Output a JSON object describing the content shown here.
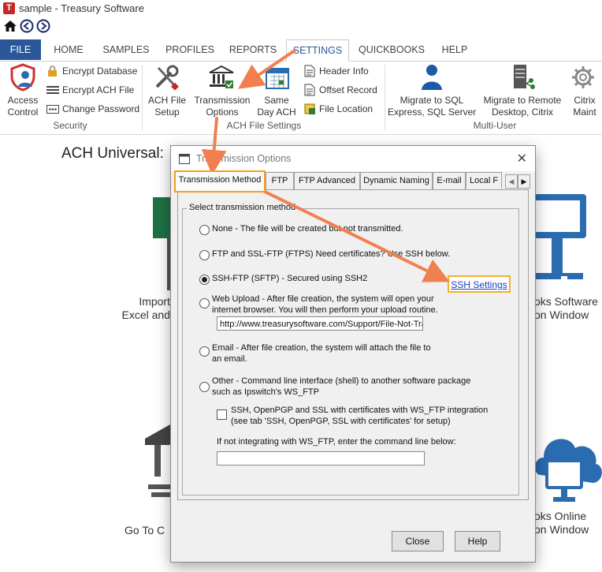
{
  "window": {
    "title": "sample - Treasury Software"
  },
  "ribbon_tabs": [
    "FILE",
    "HOME",
    "SAMPLES",
    "PROFILES",
    "REPORTS",
    "SETTINGS",
    "QUICKBOOKS",
    "HELP"
  ],
  "ribbon": {
    "access_control": "Access\nControl",
    "encrypt_database": "Encrypt Database",
    "encrypt_ach_file": "Encrypt ACH File",
    "change_password": "Change Password",
    "security_group": "Security",
    "ach_file_setup": "ACH File\nSetup",
    "transmission_options": "Transmission\nOptions",
    "same_day_ach": "Same\nDay ACH",
    "header_info": "Header Info",
    "offset_record": "Offset Record",
    "file_location": "File Location",
    "ach_file_settings_group": "ACH File Settings",
    "migrate_sql": "Migrate to SQL\nExpress, SQL Server",
    "migrate_remote": "Migrate to Remote\nDesktop, Citrix",
    "citrix_maint": "Citrix\nMaint",
    "multi_user_group": "Multi-User"
  },
  "main": {
    "heading": "ACH Universal:",
    "import_label": "Import\nExcel and",
    "quickbooks_label": "oks Software\non Window",
    "goto_label": "Go To C",
    "qb_online_label": "oks Online\non Window"
  },
  "dialog": {
    "title": "Transmission Options",
    "close_glyph": "✕",
    "tabs": [
      "Transmission Method",
      "FTP",
      "FTP Advanced",
      "Dynamic Naming",
      "E-mail",
      "Local F"
    ],
    "group_label": "Select transmission method",
    "options": {
      "none": "None - The file will be created but not transmitted.",
      "ftp_ssl": "FTP and SSL-FTP (FTPS) Need certificates? Use SSH below.",
      "ssh_ftp": "SSH-FTP (SFTP) - Secured using SSH2",
      "web_upload": "Web Upload - After file creation, the system will open your internet browser.  You will then perform your upload routine.",
      "email": "Email - After file creation, the system will attach the file to an email.",
      "other": "Other - Command line interface (shell) to another software package such as Ipswitch's WS_FTP"
    },
    "web_upload_url": "http://www.treasurysoftware.com/Support/File-Not-Tra",
    "ssh_settings_link": "SSH Settings",
    "ws_ftp_checkbox": "SSH, OpenPGP and SSL with certificates with WS_FTP integration (see tab 'SSH, OpenPGP, SSL with certificates' for setup)",
    "command_line_label": "If not integrating with WS_FTP, enter the command line below:",
    "command_line_value": "",
    "close_button": "Close",
    "help_button": "Help",
    "selected_option": "ssh_ftp"
  },
  "colors": {
    "file_tab": "#2b579a",
    "annotation_arrow": "#f08050",
    "highlight": "#f0b030",
    "accent_blue": "#2b6cb0"
  }
}
